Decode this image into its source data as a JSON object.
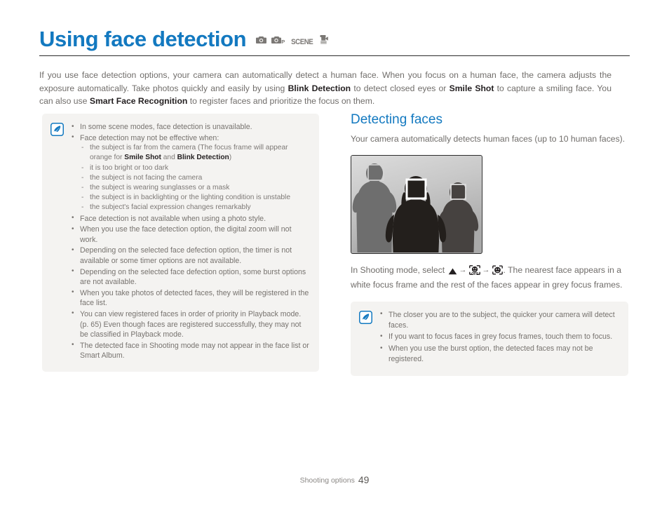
{
  "header": {
    "title": "Using face detection",
    "mode_icons": [
      {
        "name": "camera-auto-icon",
        "label": ""
      },
      {
        "name": "camera-program-icon",
        "label": "P"
      },
      {
        "name": "scene-mode-icon",
        "label": "SCENE"
      },
      {
        "name": "movie-mode-icon",
        "label": ""
      }
    ]
  },
  "intro": {
    "part1": "If you use face detection options, your camera can automatically detect a human face. When you focus on a human face, the camera adjusts the exposure automatically. Take photos quickly and easily by using ",
    "bold1": "Blink Detection",
    "part2": " to detect closed eyes or ",
    "bold2": "Smile Shot",
    "part3": " to capture a smiling face. You can also use ",
    "bold3": "Smart Face Recognition",
    "part4": " to register faces and prioritize the focus on them."
  },
  "left_note": {
    "icon": "note-pen-icon",
    "items": [
      "In some scene modes, face detection is unavailable.",
      "Face detection may not be effective when:",
      "Face detection is not available when using a photo style.",
      "When you use the face detection option, the digital zoom will not work.",
      "Depending on the selected face defection option, the timer is not available or some timer options are not available.",
      "Depending on the selected face defection option, some burst options are not available.",
      "When you take photos of detected faces, they will be registered in the face list.",
      "You can view registered faces in order of priority in Playback mode. (p. 65) Even though faces are registered successfully, they may not be classified in Playback mode.",
      "The detected face in Shooting mode may not appear in the face list or Smart Album."
    ],
    "sub_items": {
      "s1_a": "the subject is far from the camera (The focus frame will appear orange for ",
      "s1_b": "Smile Shot",
      "s1_c": " and ",
      "s1_d": "Blink Detection",
      "s1_e": ")",
      "s2": "it is too bright or too dark",
      "s3": "the subject is not facing the camera",
      "s4": "the subject is wearing sunglasses or a mask",
      "s5": "the subject is in backlighting or the lighting condition is unstable",
      "s6": "the subject's facial expression changes remarkably"
    }
  },
  "right": {
    "section_title": "Detecting faces",
    "section_para": "Your camera automatically detects human faces (up to 10 human faces).",
    "illustration": {
      "name": "face-detection-example-photo",
      "figures": [
        {
          "name": "figure-left",
          "color": "#6e6e6e",
          "frame": "grey"
        },
        {
          "name": "figure-center",
          "color": "#231f1c",
          "frame": "white"
        },
        {
          "name": "figure-right",
          "color": "#464240",
          "frame": "grey"
        }
      ]
    },
    "instruction": {
      "part1": "In Shooting mode, select ",
      "icon1": "menu-triangle-icon",
      "arrow1": "→",
      "icon2": "face-detection-off-icon",
      "arrow2": "→",
      "icon3": "face-detection-normal-icon",
      "part2": ". The nearest face appears in a white focus frame and the rest of the faces appear in grey focus frames."
    },
    "note": {
      "icon": "note-pen-icon",
      "items": [
        "The closer you are to the subject, the quicker your camera will detect faces.",
        "If you want to focus faces in grey focus frames, touch them to focus.",
        "When you use the burst option, the detected faces may not be registered."
      ]
    }
  },
  "footer": {
    "section_label": "Shooting options",
    "page_number": "49"
  },
  "colors": {
    "accent_blue": "#1379c0",
    "body_text": "#706d6a",
    "note_bg": "#f4f3f1",
    "rule": "#2b2b2b"
  }
}
